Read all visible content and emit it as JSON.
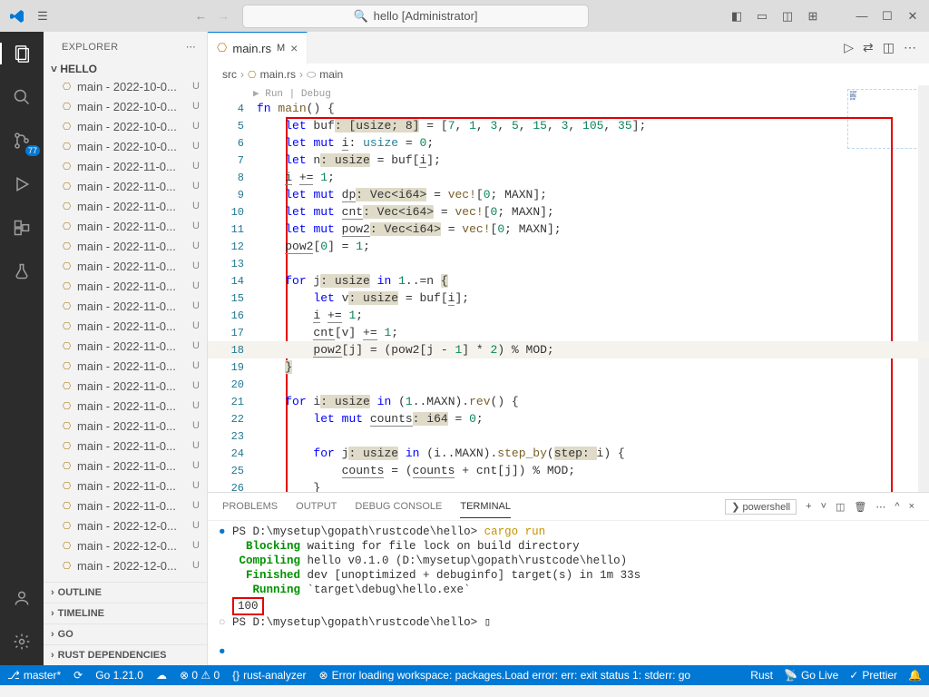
{
  "title": {
    "search_text": "hello [Administrator]"
  },
  "sidebar": {
    "header": "EXPLORER",
    "folder": "HELLO",
    "files": [
      "main - 2022-10-0...",
      "main - 2022-10-0...",
      "main - 2022-10-0...",
      "main - 2022-10-0...",
      "main - 2022-11-0...",
      "main - 2022-11-0...",
      "main - 2022-11-0...",
      "main - 2022-11-0...",
      "main - 2022-11-0...",
      "main - 2022-11-0...",
      "main - 2022-11-0...",
      "main - 2022-11-0...",
      "main - 2022-11-0...",
      "main - 2022-11-0...",
      "main - 2022-11-0...",
      "main - 2022-11-0...",
      "main - 2022-11-0...",
      "main - 2022-11-0...",
      "main - 2022-11-0...",
      "main - 2022-11-0...",
      "main - 2022-11-0...",
      "main - 2022-11-0...",
      "main - 2022-12-0...",
      "main - 2022-12-0...",
      "main - 2022-12-0..."
    ],
    "badge": "U",
    "sections": [
      "OUTLINE",
      "TIMELINE",
      "GO",
      "RUST DEPENDENCIES"
    ]
  },
  "activity": {
    "scm_badge": "77"
  },
  "tab": {
    "name": "main.rs",
    "modified": "M"
  },
  "breadcrumb": {
    "p1": "src",
    "p2": "main.rs",
    "p3": "main"
  },
  "code_lens": "Run | Debug",
  "code": {
    "lines": [
      {
        "n": "4"
      },
      {
        "n": "5"
      },
      {
        "n": "6"
      },
      {
        "n": "7"
      },
      {
        "n": "8"
      },
      {
        "n": "9"
      },
      {
        "n": "10"
      },
      {
        "n": "11"
      },
      {
        "n": "12"
      },
      {
        "n": "13"
      },
      {
        "n": "14"
      },
      {
        "n": "15"
      },
      {
        "n": "16"
      },
      {
        "n": "17"
      },
      {
        "n": "18"
      },
      {
        "n": "19"
      },
      {
        "n": "20"
      },
      {
        "n": "21"
      },
      {
        "n": "22"
      },
      {
        "n": "23"
      },
      {
        "n": "24"
      },
      {
        "n": "25"
      },
      {
        "n": "26"
      }
    ],
    "l4": "fn main() {",
    "l5_a": "    let buf",
    "l5_b": ": [usize; 8]",
    "l5_c": " = [",
    "l5_d": "7, 1, 3, 5, 15, 3, 105, 35",
    "l5_e": "];",
    "l6_a": "    let mut ",
    "l6_b": "i",
    "l6_c": ": usize = ",
    "l6_d": "0",
    "l6_e": ";",
    "l7_a": "    let n",
    "l7_b": ": usize",
    "l7_c": " = buf[",
    "l7_d": "i",
    "l7_e": "];",
    "l8_a": "    ",
    "l8_b": "i += 1",
    "l8_c": ";",
    "l9_a": "    let mut ",
    "l9_b": "dp",
    "l9_c": ": Vec<i64>",
    "l9_d": " = vec![",
    "l9_e": "0",
    "l9_f": "; MAXN];",
    "l10_a": "    let mut ",
    "l10_b": "cnt",
    "l10_c": ": Vec<i64>",
    "l10_d": " = vec![",
    "l10_e": "0",
    "l10_f": "; MAXN];",
    "l11_a": "    let mut ",
    "l11_b": "pow2",
    "l11_c": ": Vec<i64>",
    "l11_d": " = vec![",
    "l11_e": "0",
    "l11_f": "; MAXN];",
    "l12_a": "    pow2[",
    "l12_b": "0",
    "l12_c": "] = ",
    "l12_d": "1",
    "l12_e": ";",
    "l14_a": "    for j",
    "l14_b": ": usize",
    "l14_c": " in ",
    "l14_d": "1",
    "l14_e": "..=n ",
    "l14_f": "{",
    "l15_a": "        let v",
    "l15_b": ": usize",
    "l15_c": " = buf[",
    "l15_d": "i",
    "l15_e": "];",
    "l16_a": "        ",
    "l16_b": "i += ",
    "l16_c": "1",
    "l16_d": ";",
    "l17_a": "        ",
    "l17_b": "cnt[v] += ",
    "l17_c": "1",
    "l17_d": ";",
    "l18_a": "        ",
    "l18_b": "pow2[j]",
    "l18_c": " = (pow2[j - ",
    "l18_d": "1",
    "l18_e": "] * ",
    "l18_f": "2",
    "l18_g": ") % MOD;",
    "l19": "    }",
    "l21_a": "    for i",
    "l21_b": ": usize",
    "l21_c": " in (",
    "l21_d": "1",
    "l21_e": "..MAXN).rev() {",
    "l22_a": "        let mut ",
    "l22_b": "counts",
    "l22_c": ": i64",
    "l22_d": " = ",
    "l22_e": "0",
    "l22_f": ";",
    "l24_a": "        for j",
    "l24_b": ": usize",
    "l24_c": " in (i..MAXN).step_by(",
    "l24_d": "step: ",
    "l24_e": "i) {",
    "l25_a": "            ",
    "l25_b": "counts",
    "l25_c": " = (",
    "l25_d": "counts",
    "l25_e": " + cnt[j]) % MOD;",
    "l26": "        }"
  },
  "panel": {
    "tabs": [
      "PROBLEMS",
      "OUTPUT",
      "DEBUG CONSOLE",
      "TERMINAL"
    ],
    "shell": "powershell",
    "t1": "PS D:\\mysetup\\gopath\\rustcode\\hello> ",
    "t1b": "cargo run",
    "t2a": "    Blocking",
    "t2b": " waiting for file lock on build directory",
    "t3a": "   Compiling",
    "t3b": " hello v0.1.0 (D:\\mysetup\\gopath\\rustcode\\hello)",
    "t4a": "    Finished",
    "t4b": " dev [unoptimized + debuginfo] target(s) in 1m 33s",
    "t5a": "     Running",
    "t5b": " `target\\debug\\hello.exe`",
    "t6": "100",
    "t7": "PS D:\\mysetup\\gopath\\rustcode\\hello> "
  },
  "status": {
    "branch": "master*",
    "go": "Go 1.21.0",
    "ra": "rust-analyzer",
    "err": "Error loading workspace: packages.Load error: err: exit status 1: stderr: go",
    "lang": "Rust",
    "golive": "Go Live",
    "prettier": "Prettier"
  }
}
